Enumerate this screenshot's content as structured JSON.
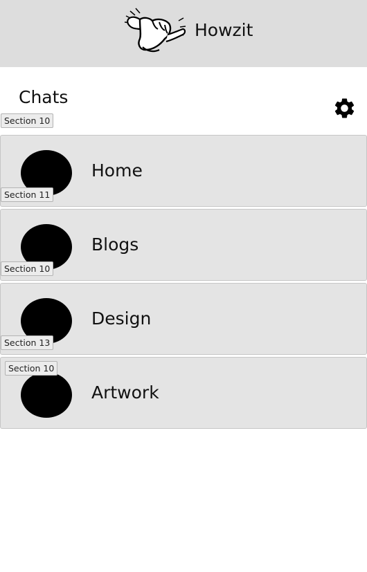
{
  "header": {
    "app_title": "Howzit",
    "logo_icon": "shaka-hand-icon"
  },
  "page": {
    "title": "Chats",
    "settings_icon": "gear-icon"
  },
  "chats": [
    {
      "label": "Home",
      "section": "Section 11"
    },
    {
      "label": "Blogs",
      "section": "Section 10"
    },
    {
      "label": "Design",
      "section": "Section 13"
    },
    {
      "label": "Artwork",
      "section": "Section 10"
    }
  ],
  "title_section": "Section 10",
  "colors": {
    "header_bg": "#dddddd",
    "row_bg": "#e4e4e4",
    "avatar": "#000000"
  }
}
